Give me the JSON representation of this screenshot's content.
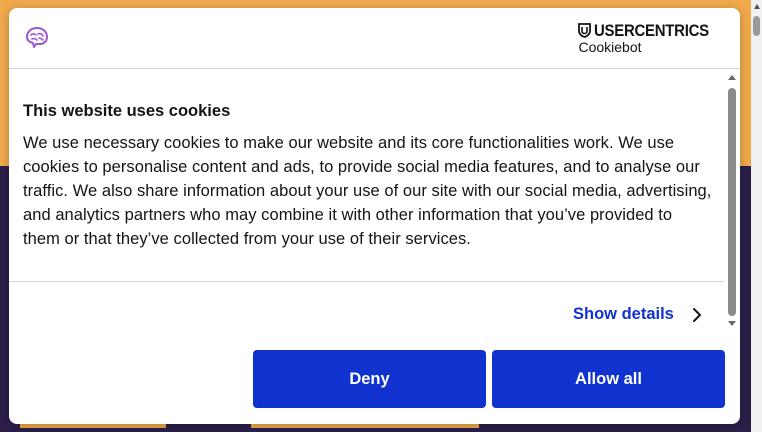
{
  "brand": {
    "name": "USERCENTRICS",
    "product": "Cookiebot"
  },
  "dialog": {
    "title": "This website uses cookies",
    "body": "We use necessary cookies to make our website and its core functionalities work. We use cookies to personalise content and ads, to provide social media features, and to analyse our traffic. We also share information about your use of our site with our social media, advertising, and analytics partners who may combine it with other information that you’ve provided to them or that they’ve collected from your use of their services.",
    "show_details_label": "Show details",
    "deny_label": "Deny",
    "allow_all_label": "Allow all"
  },
  "icons": {
    "logo": "brain-icon",
    "brand_mark": "shield-icon",
    "details_arrow": "chevron-right-icon"
  },
  "colors": {
    "accent": "#1032cf",
    "logo_purple": "#9b59d6",
    "page_top": "#f1a94b",
    "page_bottom": "#2b1f4a"
  }
}
